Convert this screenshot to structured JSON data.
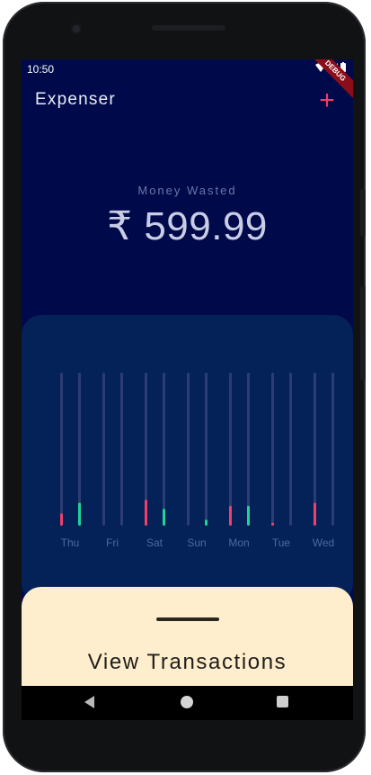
{
  "status_bar": {
    "time": "10:50",
    "debug_banner": "DEBUG"
  },
  "app_bar": {
    "title": "Expenser",
    "add_icon": "plus-icon",
    "add_symbol": "+"
  },
  "summary": {
    "label": "Money Wasted",
    "amount": "₹ 599.99"
  },
  "chart_data": {
    "type": "bar",
    "categories": [
      "Thu",
      "Fri",
      "Sat",
      "Sun",
      "Mon",
      "Tue",
      "Wed"
    ],
    "series": [
      {
        "values": [
          0.08,
          0.0,
          0.17,
          0.0,
          0.13,
          0.02,
          0.15
        ],
        "color": "#f0406a"
      },
      {
        "values": [
          0.15,
          0.0,
          0.11,
          0.04,
          0.13,
          0.0,
          0.0
        ],
        "color": "#1fd39a"
      }
    ],
    "ylim": [
      0,
      1
    ],
    "track_color": "#2b3d73"
  },
  "sheet": {
    "title": "View Transactions"
  },
  "nav_bar": {
    "back_icon": "back-icon",
    "home_icon": "home-icon",
    "recent_icon": "recent-apps-icon"
  }
}
